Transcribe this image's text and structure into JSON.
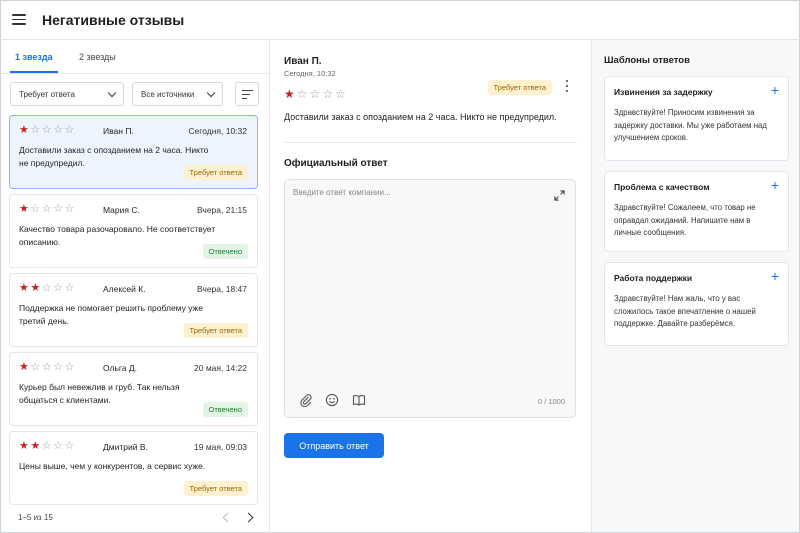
{
  "header": {
    "title": "Негативные отзывы"
  },
  "tabs": [
    {
      "label": "1 звезда"
    },
    {
      "label": "2 звезды"
    }
  ],
  "filters": {
    "status": "Требует ответа",
    "source": "Все источники"
  },
  "reviews": [
    {
      "stars": 1,
      "name": "Иван П.",
      "date": "Сегодня, 10:32",
      "text": "Доставили заказ с опозданием на 2 часа. Никто не предупредил.",
      "status": "Требует ответа",
      "status_type": "pending"
    },
    {
      "stars": 1,
      "name": "Мария С.",
      "date": "Вчера, 21:15",
      "text": "Качество товара разочаровало. Не соответствует описанию.",
      "status": "Отвечено",
      "status_type": "done"
    },
    {
      "stars": 2,
      "name": "Алексей К.",
      "date": "Вчера, 18:47",
      "text": "Поддержка не помогает решить проблему уже третий день.",
      "status": "Требует ответа",
      "status_type": "pending"
    },
    {
      "stars": 1,
      "name": "Ольга Д.",
      "date": "20 мая, 14:22",
      "text": "Курьер был невежлив и груб. Так нельзя общаться с клиентами.",
      "status": "Отвечено",
      "status_type": "done"
    },
    {
      "stars": 2,
      "name": "Дмитрий В.",
      "date": "19 мая, 09:03",
      "text": "Цены выше, чем у конкурентов, а сервис хуже.",
      "status": "Требует ответа",
      "status_type": "pending"
    }
  ],
  "pagination": {
    "text": "1–5 из 15"
  },
  "detail": {
    "name": "Иван П.",
    "date": "Сегодня, 10:32",
    "stars": 1,
    "status": "Требует ответа",
    "text": "Доставили заказ с опозданием на 2 часа. Никто не предупредил."
  },
  "reply": {
    "title": "Официальный ответ",
    "placeholder": "Введите ответ компании...",
    "counter": "0 / 1000",
    "send_label": "Отправить ответ"
  },
  "templates": {
    "title": "Шаблоны ответов",
    "items": [
      {
        "title": "Извинения за задержку",
        "text": "Здравствуйте! Приносим извинения за задержку доставки. Мы уже работаем над улучшением сроков."
      },
      {
        "title": "Проблема с качеством",
        "text": "Здравствуйте! Сожалеем, что товар не оправдал ожиданий. Напишите нам в личные сообщения."
      },
      {
        "title": "Работа поддержки",
        "text": "Здравствуйте! Нам жаль, что у вас сложилось такое впечатление о нашей поддержке. Давайте разберёмся."
      }
    ]
  },
  "colors": {
    "accent": "#1a73e8",
    "star": "#c5221f",
    "pending_bg": "#fdf1cf",
    "done_bg": "#e3f4e4"
  },
  "icons": [
    "menu-icon",
    "chevron-down-icon",
    "sort-icon",
    "star-icon",
    "more-vertical-icon",
    "expand-icon",
    "attach-icon",
    "emoji-icon",
    "book-icon",
    "plus-icon",
    "chevron-left-icon",
    "chevron-right-icon"
  ]
}
